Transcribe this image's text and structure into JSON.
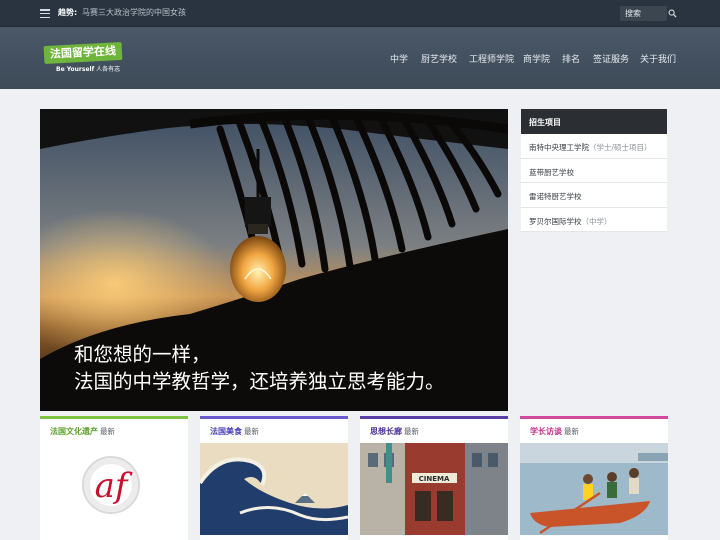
{
  "topbar": {
    "trend_label": "趋势:",
    "trend_text": "马赛三大政治学院的中国女孩",
    "search_placeholder": "搜索"
  },
  "logo": {
    "title": "法国留学在线",
    "tagline_en": "Be Yourself",
    "tagline_cn": "人各有志"
  },
  "nav": [
    "中学",
    "厨艺学校",
    "工程师学院",
    "商学院",
    "排名",
    "签证服务",
    "关于我们"
  ],
  "hero": {
    "caption_line1": "和您想的一样，",
    "caption_line2": "法国的中学教哲学，还培养独立思考能力。"
  },
  "sidebar": {
    "title": "招生项目",
    "items": [
      {
        "label": "南特中央理工学院",
        "sub": "（学士/硕士项目）"
      },
      {
        "label": "蓝带厨艺学校",
        "sub": ""
      },
      {
        "label": "雷诺特厨艺学校",
        "sub": ""
      },
      {
        "label": "罗贝尔国际学校",
        "sub": "（中学）"
      }
    ]
  },
  "cards": [
    {
      "category": "法国文化遗产",
      "latest": "最新",
      "color": "#7cc142"
    },
    {
      "category": "法国美食",
      "latest": "最新",
      "color": "#6a5acd"
    },
    {
      "category": "思想长廊",
      "latest": "最新",
      "color": "#5b3fa8"
    },
    {
      "category": "学长访谈",
      "latest": "最新",
      "color": "#d24a9c"
    }
  ],
  "colors": {
    "topbar_bg": "#2a3440",
    "header_bg": "#445262",
    "sidebar_head": "#2b2f33"
  }
}
